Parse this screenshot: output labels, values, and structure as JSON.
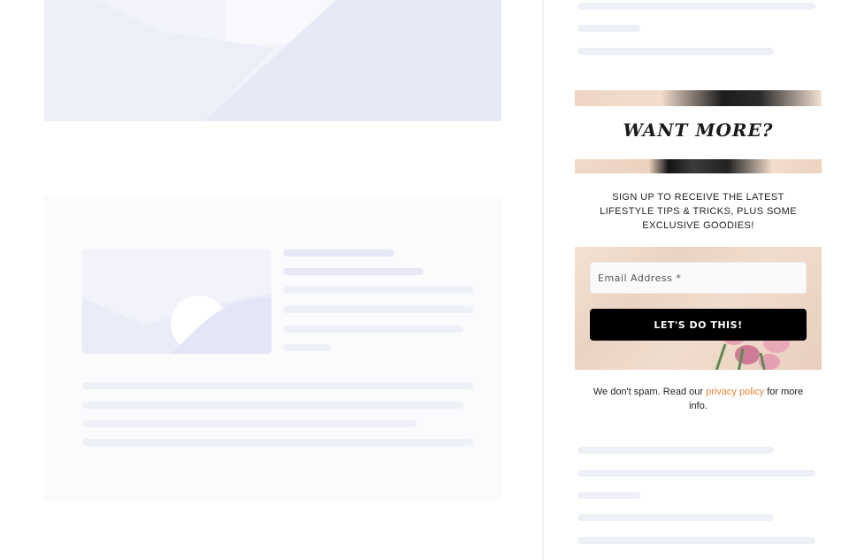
{
  "optin": {
    "headline": "WANT MORE?",
    "subtext": "SIGN UP TO RECEIVE THE LATEST LIFESTYLE TIPS & TRICKS, PLUS SOME EXCLUSIVE GOODIES!",
    "email_placeholder": "Email Address *",
    "submit_label": "LET'S DO THIS!",
    "disclaimer_before": "We don't spam. Read our",
    "disclaimer_link": "privacy policy",
    "disclaimer_after": "for more info."
  },
  "colors": {
    "link": "#e8833a",
    "button": "#000000",
    "skeleton": "#eef0f8",
    "placeholder_bg": "#f2f3fb"
  }
}
